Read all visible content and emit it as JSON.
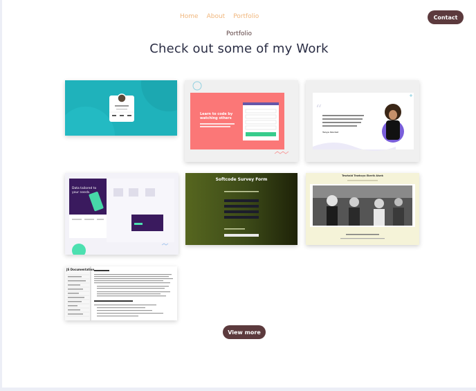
{
  "nav": {
    "items": [
      "Home",
      "About",
      "Portfolio"
    ],
    "contact_label": "Contact"
  },
  "section": {
    "subtitle": "Portfolio",
    "title": "Check out some of my Work"
  },
  "projects": [
    {
      "name": "profile-card"
    },
    {
      "name": "signup-form",
      "heading": "Learn to code by watching others"
    },
    {
      "name": "testimonial",
      "author": "Tanya Sinclair"
    },
    {
      "name": "landing-page",
      "hero_text": "Data tailored to your needs."
    },
    {
      "name": "survey-form",
      "heading": "Softcode Survey Form"
    },
    {
      "name": "tribute-page",
      "heading": "Tewhaid Tewhoyo Ekerik Alsek"
    },
    {
      "name": "documentation-page",
      "heading": "JS Documentation"
    }
  ],
  "view_more_label": "View more"
}
